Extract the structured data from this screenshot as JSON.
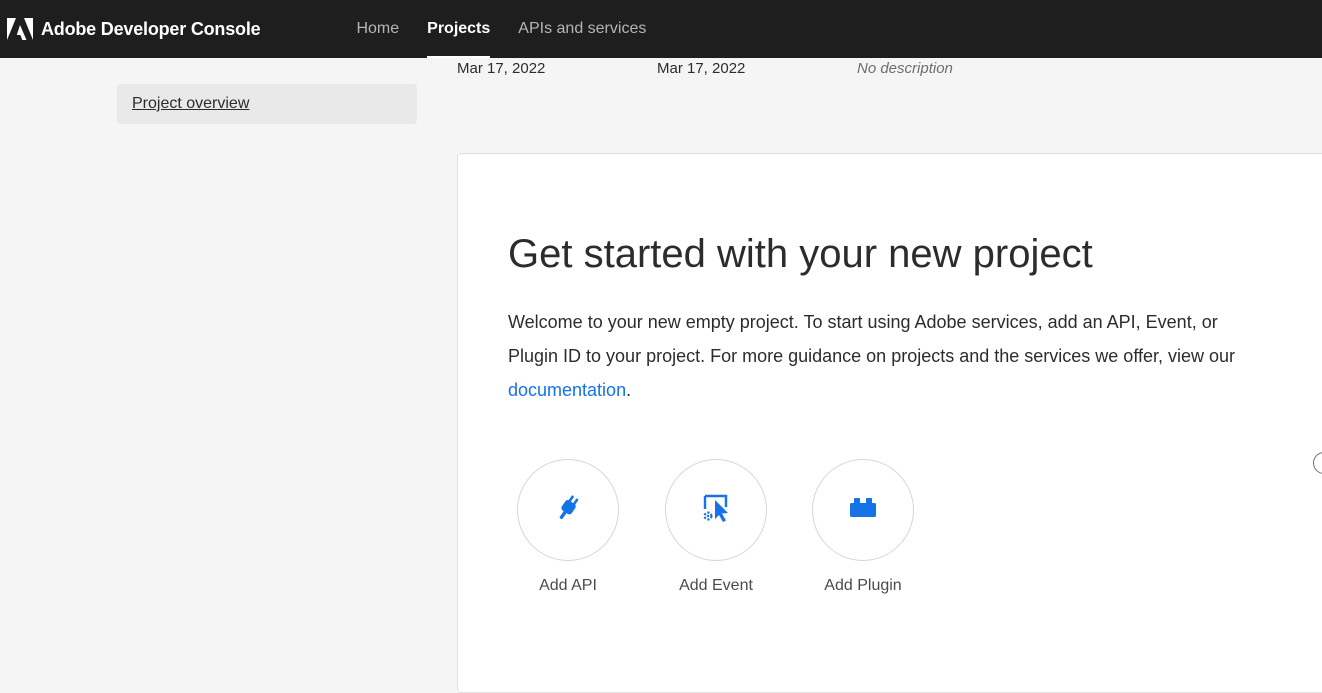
{
  "header": {
    "logo_icon": "adobe-logo-icon",
    "title": "Adobe Developer Console",
    "nav": [
      {
        "label": "Home",
        "active": false
      },
      {
        "label": "Projects",
        "active": true
      },
      {
        "label": "APIs and services",
        "active": false
      }
    ]
  },
  "sidebar": {
    "items": [
      {
        "label": "Project overview",
        "selected": true
      }
    ]
  },
  "project_meta": {
    "created": "Mar 17, 2022",
    "modified": "Mar 17, 2022",
    "description": "No description"
  },
  "get_started": {
    "title": "Get started with your new project",
    "body_text": "Welcome to your new empty project. To start using Adobe services, add an API, Event, or Plugin ID to your project. For more guidance on projects and the services we offer, view our ",
    "link_text": "documentation",
    "body_suffix": ".",
    "actions": [
      {
        "label": "Add API",
        "icon": "plug-icon"
      },
      {
        "label": "Add Event",
        "icon": "event-icon"
      },
      {
        "label": "Add Plugin",
        "icon": "plugin-block-icon"
      }
    ]
  },
  "colors": {
    "topbar": "#1e1e1e",
    "accent_blue": "#1473e6",
    "page_bg": "#f5f5f5",
    "card_bg": "#ffffff"
  }
}
